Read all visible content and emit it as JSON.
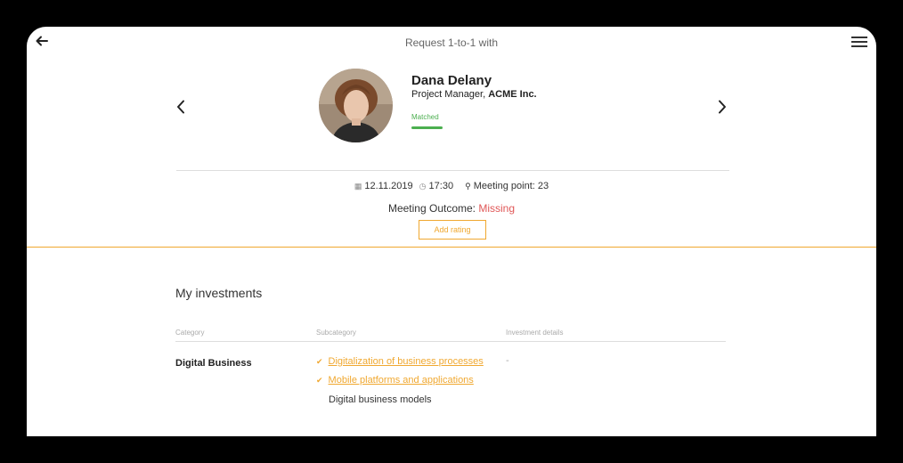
{
  "header": {
    "title": "Request 1-to-1 with",
    "back_icon": "arrow-left-icon",
    "menu_icon": "hamburger-menu-icon"
  },
  "profile": {
    "name": "Dana Delany",
    "role": "Project Manager, ",
    "company": "ACME Inc.",
    "status": "Matched",
    "status_color": "#4caf50"
  },
  "meeting": {
    "date": "12.11.2019",
    "time": "17:30",
    "point_label": "Meeting point:",
    "point_value": "23",
    "outcome_label": "Meeting Outcome:",
    "outcome_value": "Missing",
    "outcome_color": "#e05757",
    "add_rating_label": "Add rating"
  },
  "investments": {
    "title": "My investments",
    "columns": [
      "Category",
      "Subcategory",
      "Investment details"
    ],
    "rows": [
      {
        "category": "Digital Business",
        "subcategories": [
          {
            "label": "Digitalization of business processes",
            "checked": true
          },
          {
            "label": "Mobile platforms and applications",
            "checked": true
          },
          {
            "label": "Digital business models",
            "checked": false
          }
        ],
        "details": "-"
      }
    ]
  },
  "colors": {
    "accent": "#f0a830",
    "text": "#333333"
  }
}
